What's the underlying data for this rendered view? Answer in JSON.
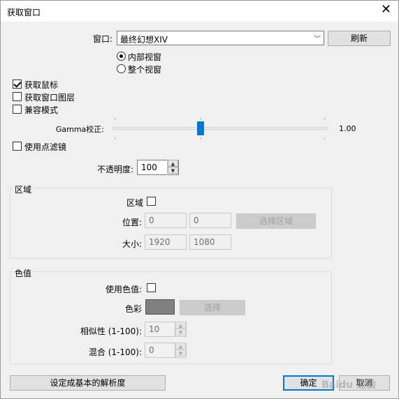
{
  "window": {
    "title": "获取窗口"
  },
  "target": {
    "label": "窗口:",
    "selected": "最终幻想XIV",
    "refresh": "刷新",
    "radio_inner": "内部视窗",
    "radio_whole": "整个视窗"
  },
  "options": {
    "capture_mouse": "获取鼠标",
    "capture_layers": "获取窗口图层",
    "compat_mode": "兼容模式",
    "gamma_label": "Gamma校正:",
    "gamma_value": "1.00",
    "gamma_fraction": 0.41,
    "use_filter": "使用点滤镜"
  },
  "opacity": {
    "label": "不透明度:",
    "value": "100"
  },
  "region": {
    "title": "区域",
    "enable_label": "区域",
    "position_label": "位置:",
    "pos_x": "0",
    "pos_y": "0",
    "select_btn": "选择区域",
    "size_label": "大小:",
    "width": "1920",
    "height": "1080"
  },
  "color": {
    "title": "色值",
    "use_label": "使用色值:",
    "color_label": "色彩",
    "select_btn": "选择",
    "swatch_color": "#808080",
    "similarity_label": "相似性 (1-100):",
    "similarity_value": "10",
    "blend_label": "混合 (1-100):",
    "blend_value": "0"
  },
  "footer": {
    "base_res": "设定成基本的解析度",
    "ok": "确定",
    "cancel": "取消"
  },
  "watermark": "Baidu 经验"
}
